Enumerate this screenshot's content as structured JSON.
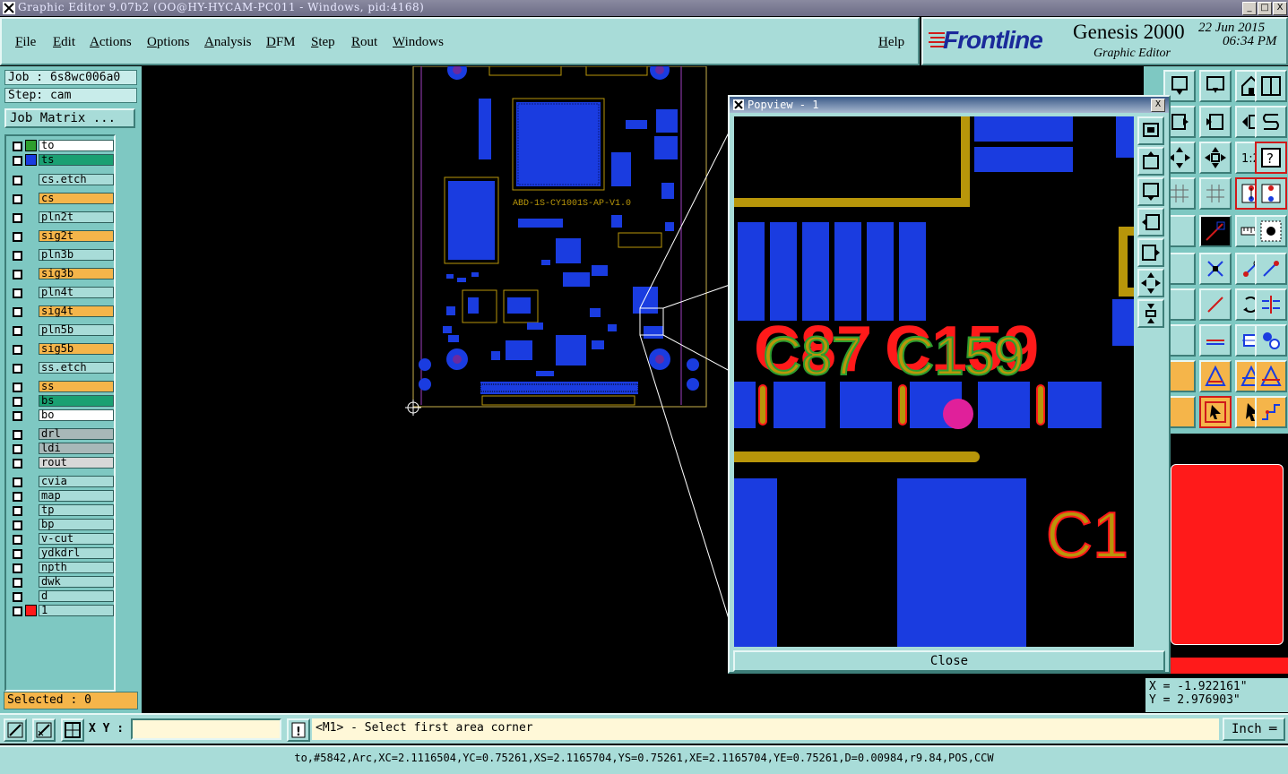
{
  "window": {
    "title": "Graphic Editor 9.07b2 (OO@HY-HYCAM-PC011 - Windows, pid:4168)",
    "minimize": "_",
    "maximize": "□",
    "close": "X"
  },
  "menu": {
    "items": [
      "File",
      "Edit",
      "Actions",
      "Options",
      "Analysis",
      "DFM",
      "Step",
      "Rout",
      "Windows"
    ],
    "help": "Help"
  },
  "brand": {
    "logo": "Frontline",
    "product": "Genesis 2000",
    "subtitle": "Graphic Editor",
    "date": "22 Jun 2015",
    "time": "06:34 PM"
  },
  "job": {
    "job_label": "Job : 6s8wc006a0",
    "step_label": "Step: cam",
    "matrix_button": "Job Matrix ..."
  },
  "layers": [
    {
      "name": "to",
      "color": "#ffffff",
      "swatch": "#2e9e2e"
    },
    {
      "name": "ts",
      "color": "#1aa072",
      "swatch": "#1a3ce0"
    },
    {
      "name": "cs.etch",
      "color": "#a8dcd8",
      "swatch": ""
    },
    {
      "name": "cs",
      "color": "#f5b54a",
      "swatch": ""
    },
    {
      "name": "pln2t",
      "color": "#a8dcd8",
      "swatch": ""
    },
    {
      "name": "sig2t",
      "color": "#f5b54a",
      "swatch": ""
    },
    {
      "name": "pln3b",
      "color": "#a8dcd8",
      "swatch": ""
    },
    {
      "name": "sig3b",
      "color": "#f5b54a",
      "swatch": ""
    },
    {
      "name": "pln4t",
      "color": "#a8dcd8",
      "swatch": ""
    },
    {
      "name": "sig4t",
      "color": "#f5b54a",
      "swatch": ""
    },
    {
      "name": "pln5b",
      "color": "#a8dcd8",
      "swatch": ""
    },
    {
      "name": "sig5b",
      "color": "#f5b54a",
      "swatch": ""
    },
    {
      "name": "ss.etch",
      "color": "#a8dcd8",
      "swatch": ""
    },
    {
      "name": "ss",
      "color": "#f5b54a",
      "swatch": ""
    },
    {
      "name": "bs",
      "color": "#1aa072",
      "swatch": ""
    },
    {
      "name": "bo",
      "color": "#ffffff",
      "swatch": ""
    },
    {
      "name": "drl",
      "color": "#a8b8b8",
      "swatch": ""
    },
    {
      "name": "ldi",
      "color": "#a8b8b8",
      "swatch": ""
    },
    {
      "name": "rout",
      "color": "#d8d8d8",
      "swatch": ""
    },
    {
      "name": "cvia",
      "color": "#a8dcd8",
      "swatch": ""
    },
    {
      "name": "map",
      "color": "#a8dcd8",
      "swatch": ""
    },
    {
      "name": "tp",
      "color": "#a8dcd8",
      "swatch": ""
    },
    {
      "name": "bp",
      "color": "#a8dcd8",
      "swatch": ""
    },
    {
      "name": "v-cut",
      "color": "#a8dcd8",
      "swatch": ""
    },
    {
      "name": "ydkdrl",
      "color": "#a8dcd8",
      "swatch": ""
    },
    {
      "name": "npth",
      "color": "#a8dcd8",
      "swatch": ""
    },
    {
      "name": "dwk",
      "color": "#a8dcd8",
      "swatch": ""
    },
    {
      "name": "d",
      "color": "#a8dcd8",
      "swatch": ""
    },
    {
      "name": "1",
      "color": "#a8dcd8",
      "swatch": "#ff1a1a"
    }
  ],
  "selected": "Selected : 0",
  "board": {
    "silk_text": "ABD-1S-CY1001S-AP-V1.0"
  },
  "popview": {
    "title": "Popview - 1",
    "labels": [
      "C87",
      "C159",
      "C1"
    ],
    "close_button": "Close"
  },
  "coords": {
    "x": "X = -1.922161\"",
    "y": "Y = 2.976903\""
  },
  "command": {
    "xy_label": "X Y :",
    "xy_value": "",
    "prompt": "<M1> - Select first area corner",
    "units": "Inch"
  },
  "status": "to,#5842,Arc,XC=2.1116504,YC=0.75261,XS=2.1165704,YS=0.75261,XE=2.1165704,YE=0.75261,D=0.00984,r9.84,POS,CCW",
  "colors": {
    "panel": "#a8dcd8",
    "orange": "#f5b54a",
    "pad_blue": "#1a3ce0",
    "trace_gold": "#b8960a",
    "silk_red": "#ff1a1a",
    "silk_green": "#2e9e2e"
  }
}
